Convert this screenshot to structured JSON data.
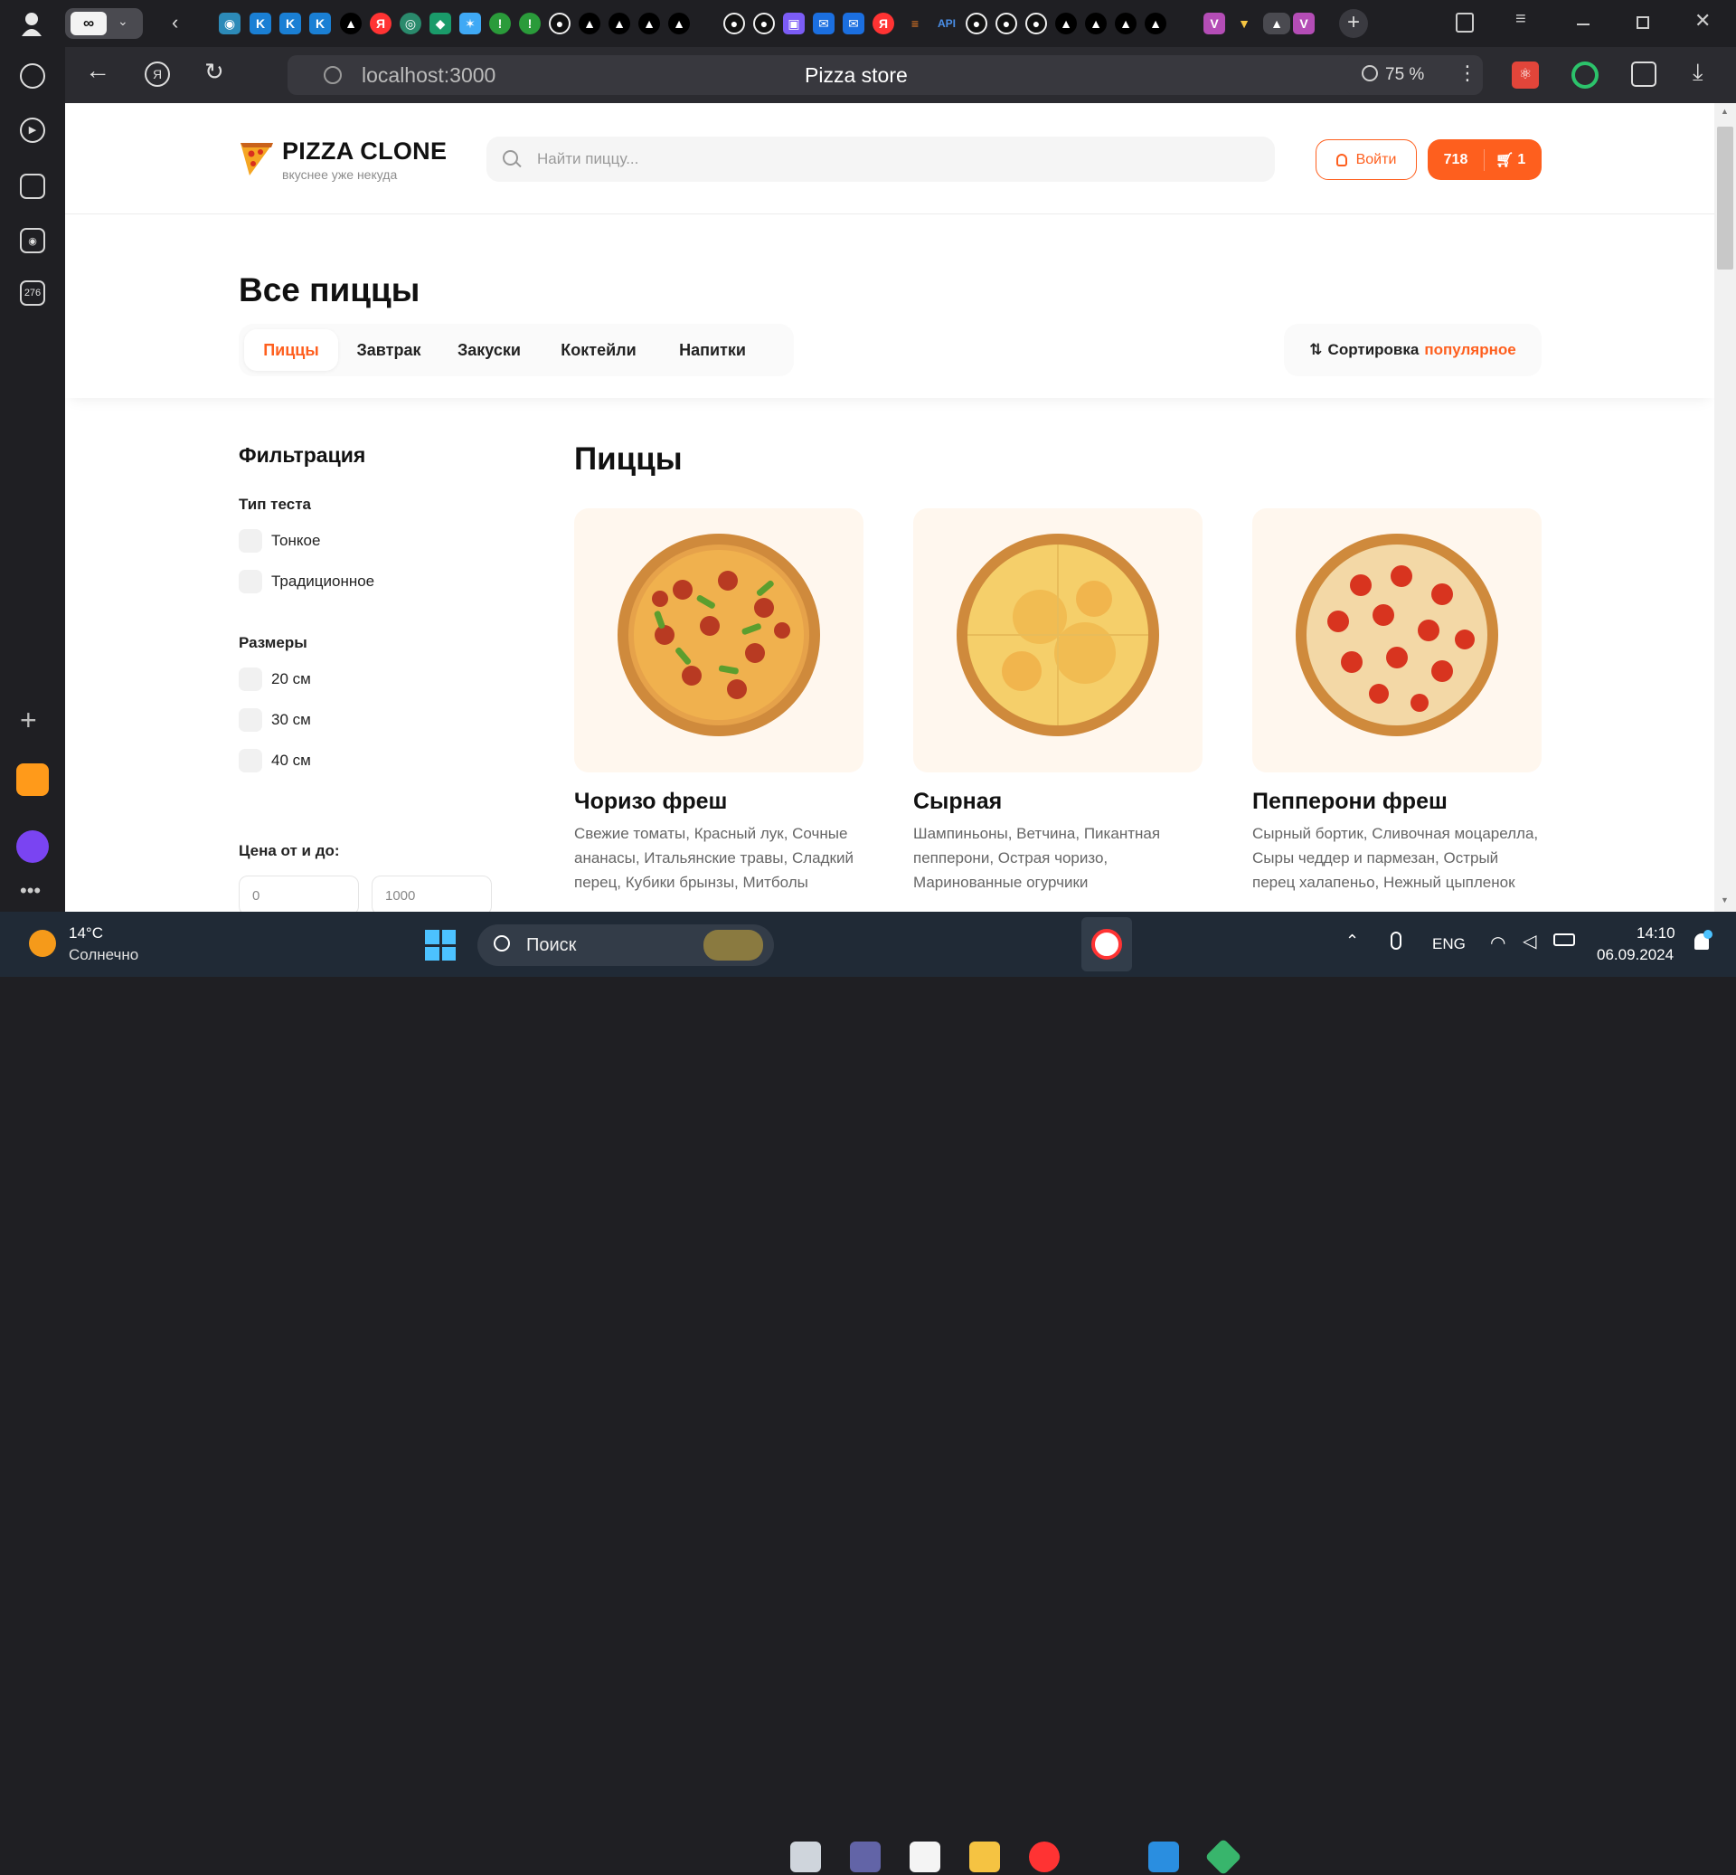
{
  "browser": {
    "page_title": "Pizza store",
    "url": "localhost:3000",
    "zoom": "75 %",
    "rail_badge": "276"
  },
  "header": {
    "logo_title": "PIZZA CLONE",
    "logo_subtitle": "вкуснее уже некуда",
    "search_placeholder": "Найти пиццу...",
    "login_label": "Войти",
    "cart_total": "718",
    "cart_count": "1"
  },
  "catalog": {
    "heading": "Все пиццы",
    "categories": [
      "Пиццы",
      "Завтрак",
      "Закуски",
      "Коктейли",
      "Напитки"
    ],
    "sort_label": "Сортировка",
    "sort_value": "популярное"
  },
  "filters": {
    "title": "Фильтрация",
    "dough_title": "Тип теста",
    "dough": [
      "Тонкое",
      "Традиционное"
    ],
    "sizes_title": "Размеры",
    "sizes": [
      "20 см",
      "30 см",
      "40 см"
    ],
    "price_title": "Цена от и до:",
    "price_from": "0",
    "price_to": "1000"
  },
  "products": {
    "section_title": "Пиццы",
    "items": [
      {
        "name": "Чоризо фреш",
        "desc": "Свежие томаты, Красный лук, Сочные ананасы, Итальянские травы, Сладкий перец, Кубики брынзы, Митболы"
      },
      {
        "name": "Сырная",
        "desc": "Шампиньоны, Ветчина, Пикантная пепперони, Острая чоризо, Маринованные огурчики"
      },
      {
        "name": "Пепперони фреш",
        "desc": "Сырный бортик, Сливочная моцарелла, Сыры чеддер и пармезан, Острый перец халапеньо, Нежный цыпленок"
      }
    ]
  },
  "taskbar": {
    "temperature": "14°C",
    "weather": "Солнечно",
    "search_label": "Поиск",
    "lang": "ENG",
    "time": "14:10",
    "date": "06.09.2024"
  },
  "colors": {
    "accent": "#fe5f1e",
    "chrome": "#1f1f23",
    "taskbar": "#202a36"
  }
}
